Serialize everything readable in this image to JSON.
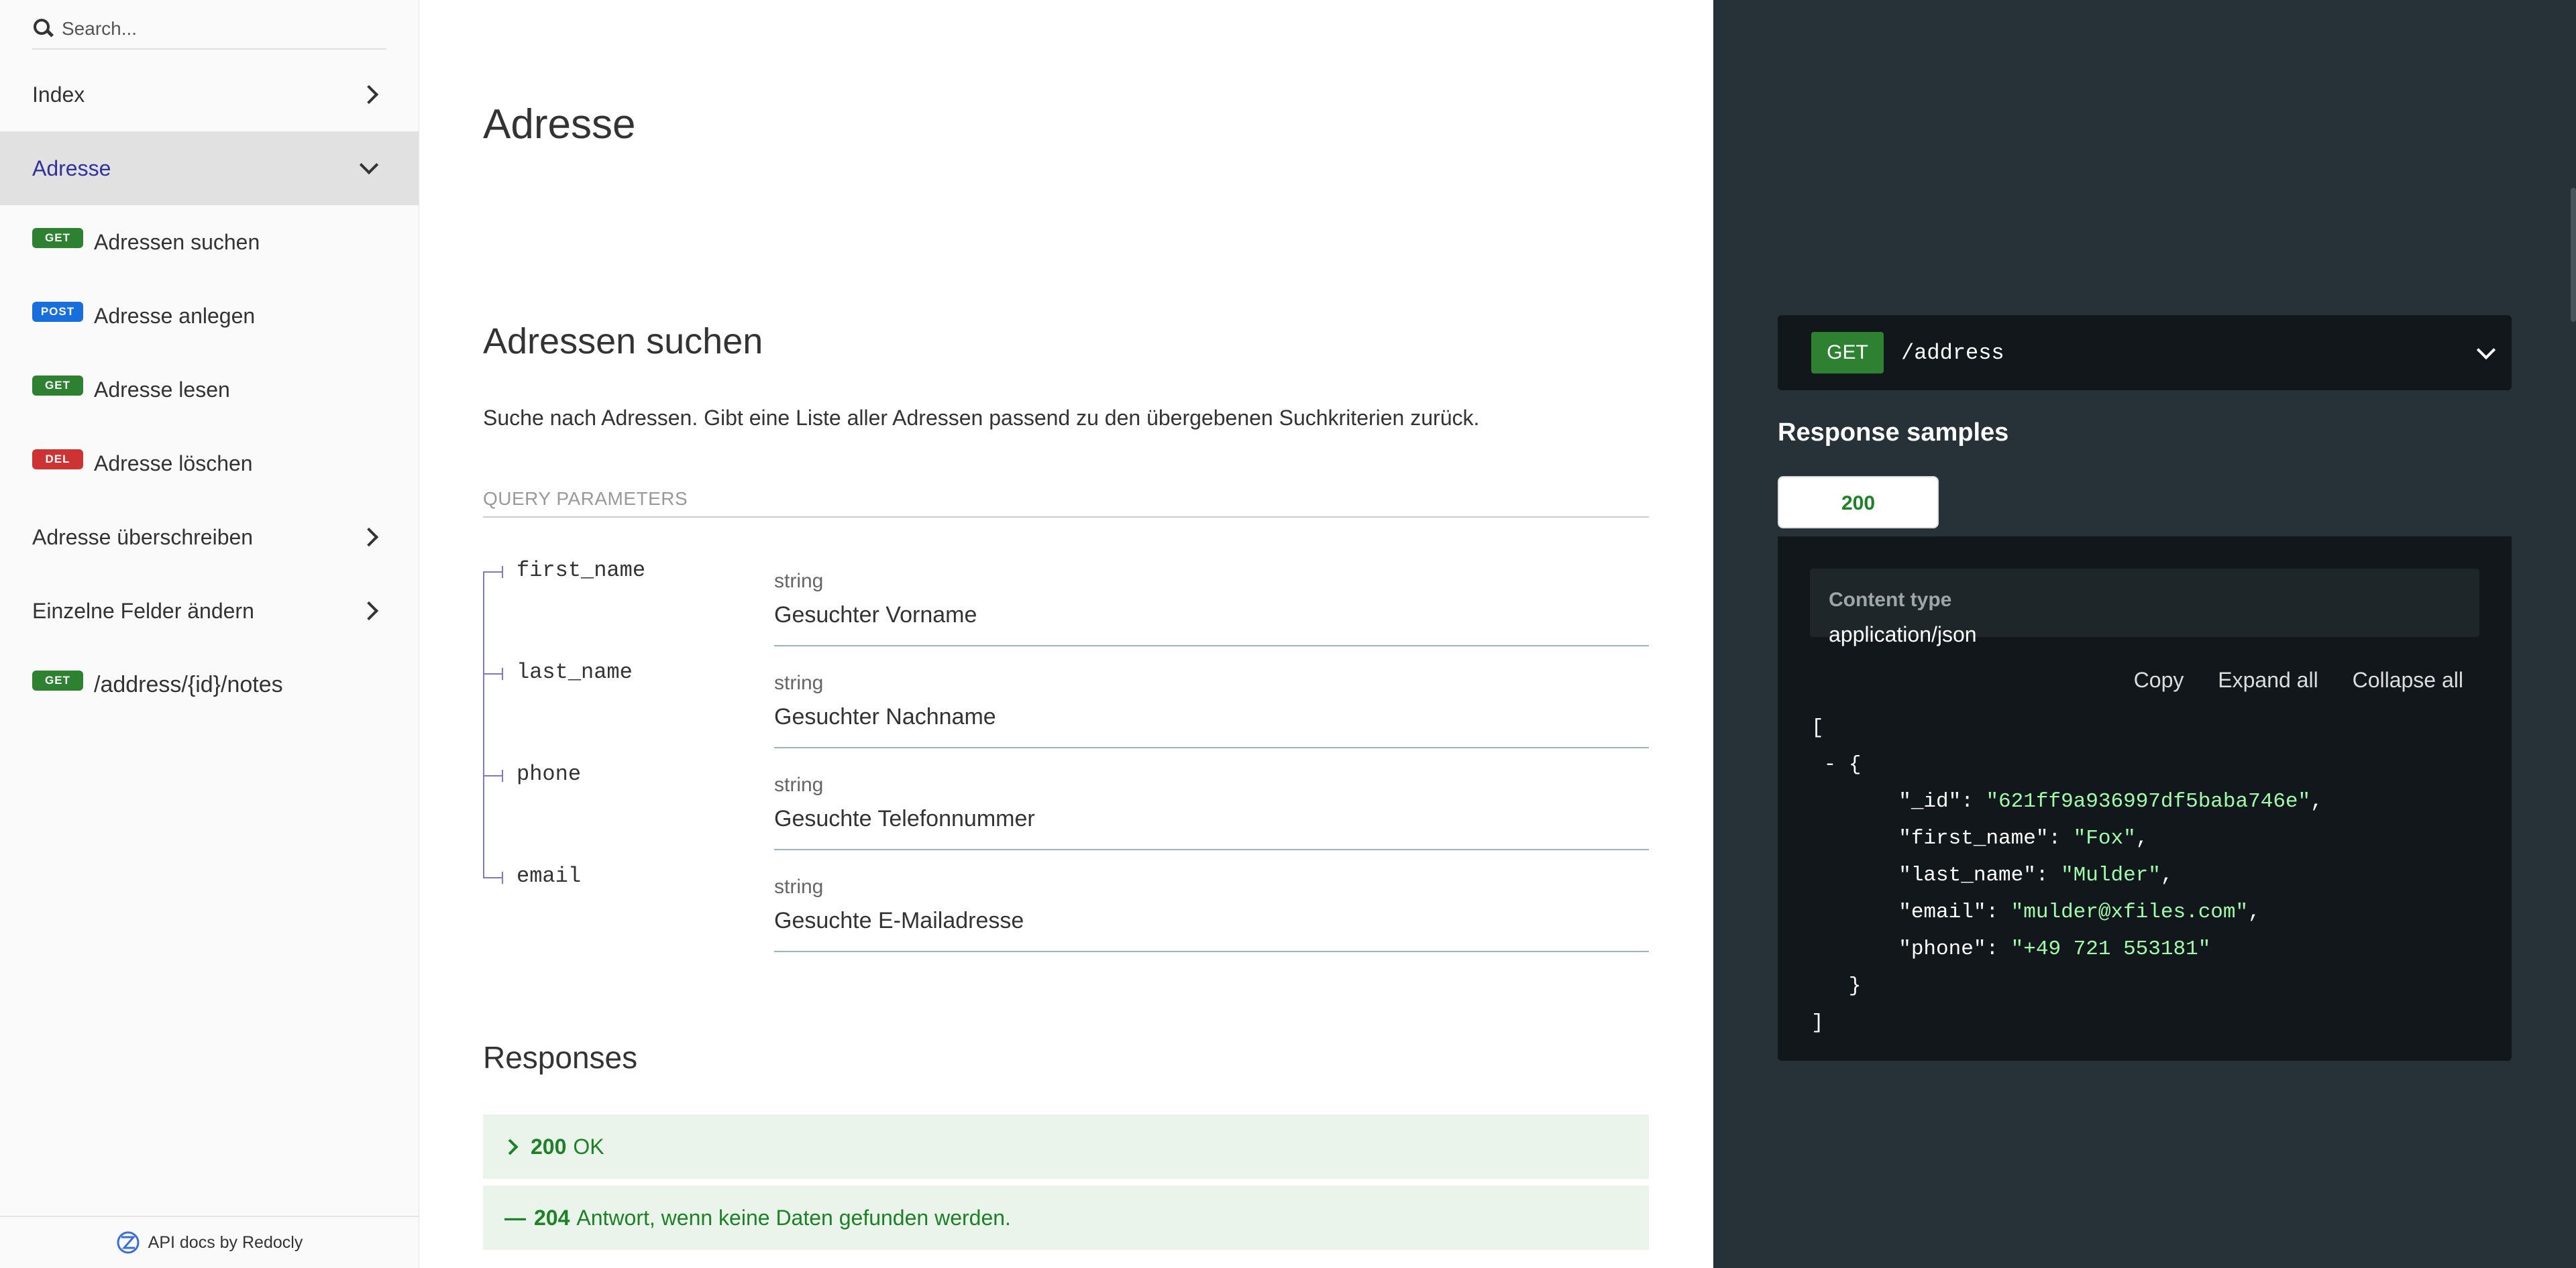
{
  "sidebar": {
    "search_placeholder": "Search...",
    "items": [
      {
        "label": "Index"
      },
      {
        "label": "Adresse"
      },
      {
        "method": "GET",
        "label": "Adressen suchen"
      },
      {
        "method": "POST",
        "label": "Adresse anlegen"
      },
      {
        "method": "GET",
        "label": "Adresse lesen"
      },
      {
        "method": "DEL",
        "label": "Adresse löschen"
      },
      {
        "label": "Adresse überschreiben"
      },
      {
        "label": "Einzelne Felder ändern"
      },
      {
        "method": "GET",
        "label": "/address/{id}/notes"
      }
    ],
    "footer": "API docs by Redocly"
  },
  "main": {
    "title": "Adresse",
    "operation_title": "Adressen suchen",
    "description": "Suche nach Adressen. Gibt eine Liste aller Adressen passend zu den übergebenen Suchkriterien zurück.",
    "query_params_title": "QUERY PARAMETERS",
    "params": [
      {
        "name": "first_name",
        "type": "string",
        "description": "Gesuchter Vorname"
      },
      {
        "name": "last_name",
        "type": "string",
        "description": "Gesuchter Nachname"
      },
      {
        "name": "phone",
        "type": "string",
        "description": "Gesuchte Telefonnummer"
      },
      {
        "name": "email",
        "type": "string",
        "description": "Gesuchte E-Mailadresse"
      }
    ],
    "responses_title": "Responses",
    "responses": [
      {
        "code": "200",
        "text": "OK"
      },
      {
        "code": "204",
        "text": "Antwort, wenn keine Daten gefunden werden."
      }
    ]
  },
  "right": {
    "method": "GET",
    "path": "/address",
    "samples_title": "Response samples",
    "tab": "200",
    "content_type_label": "Content type",
    "content_type": "application/json",
    "actions": [
      "Copy",
      "Expand all",
      "Collapse all"
    ],
    "json": {
      "_id": "\"621ff9a936997df5baba746e\"",
      "first_name": "\"Fox\"",
      "last_name": "\"Mulder\"",
      "email": "\"mulder@xfiles.com\"",
      "phone": "\"+49 721 553181\""
    }
  },
  "colors": {
    "get": "#2f8132",
    "post": "#186fdb",
    "del": "#cc3333",
    "active_nav": "#32329f",
    "right_bg": "#263238",
    "json_string": "#a0fbaa",
    "response_green": "#1d8127"
  }
}
